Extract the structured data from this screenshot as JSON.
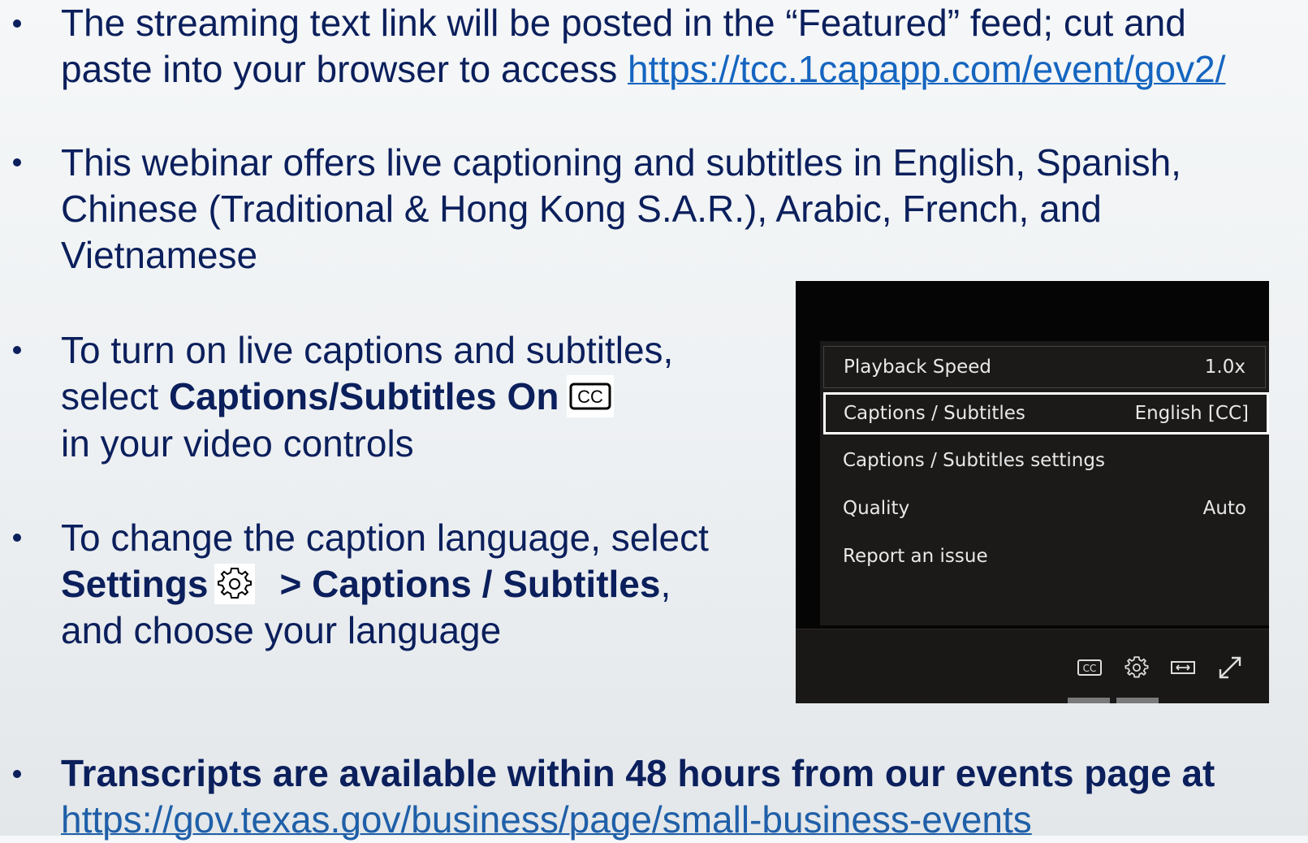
{
  "bullets": {
    "stream": {
      "line1": "The streaming text link will be posted in the “Featured” feed; cut and",
      "line2_prefix": "paste into your browser to access ",
      "link": "https://tcc.1capapp.com/event/gov2/"
    },
    "captioning": {
      "line1": "This webinar offers live captioning and subtitles in English, Spanish,",
      "line2": "Chinese (Traditional & Hong Kong S.A.R.), Arabic, French, and",
      "line3": "Vietnamese"
    },
    "turn_on": {
      "line1": "To turn on live captions and subtitles,",
      "line2_prefix": "select ",
      "line2_bold": "Captions/Subtitles On",
      "line3": "in your video controls"
    },
    "change_lang": {
      "line1": "To change the caption language, select",
      "line2_bold1": "Settings",
      "line2_bold2": "> Captions / Subtitles",
      "line2_suffix": ",",
      "line3": "and choose your language"
    },
    "transcripts": {
      "line1_bold": "Transcripts are available within 48 hours from our events page at",
      "link": "https://gov.texas.gov/business/page/small-business-events"
    }
  },
  "player": {
    "menu": [
      {
        "label": "Playback Speed",
        "value": "1.0x"
      },
      {
        "label": "Captions / Subtitles",
        "value": "English [CC]"
      },
      {
        "label": "Captions / Subtitles settings",
        "value": ""
      },
      {
        "label": "Quality",
        "value": "Auto"
      },
      {
        "label": "Report an issue",
        "value": ""
      }
    ],
    "controls": [
      "cc-icon",
      "gear-icon",
      "theater-mode-icon",
      "fullscreen-icon"
    ]
  },
  "icons": {
    "inline_cc": "cc-icon",
    "inline_settings": "gear-icon"
  },
  "colors": {
    "text": "#0b1f5c",
    "link": "#1565c0",
    "player_bg": "#050505",
    "menu_bg": "#1c1a19"
  }
}
